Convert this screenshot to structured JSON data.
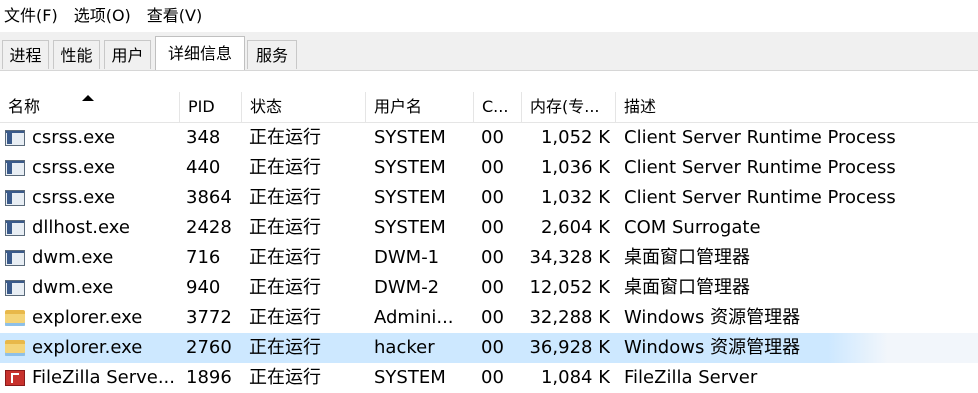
{
  "menu": [
    "文件(F)",
    "选项(O)",
    "查看(V)"
  ],
  "tabs": [
    {
      "label": "进程",
      "active": false
    },
    {
      "label": "性能",
      "active": false
    },
    {
      "label": "用户",
      "active": false
    },
    {
      "label": "详细信息",
      "active": true
    },
    {
      "label": "服务",
      "active": false
    }
  ],
  "table": {
    "headers": {
      "name": "名称",
      "pid": "PID",
      "status": "状态",
      "user": "用户名",
      "cpu": "C...",
      "mem": "内存(专...",
      "desc": "描述"
    },
    "sorted_column": "name",
    "sort_direction": "ascending",
    "rows": [
      {
        "icon": "app-window-icon",
        "name": "csrss.exe",
        "pid": "348",
        "status": "正在运行",
        "user": "SYSTEM",
        "cpu": "00",
        "mem": "1,052 K",
        "desc": "Client Server Runtime Process"
      },
      {
        "icon": "app-window-icon",
        "name": "csrss.exe",
        "pid": "440",
        "status": "正在运行",
        "user": "SYSTEM",
        "cpu": "00",
        "mem": "1,036 K",
        "desc": "Client Server Runtime Process"
      },
      {
        "icon": "app-window-icon",
        "name": "csrss.exe",
        "pid": "3864",
        "status": "正在运行",
        "user": "SYSTEM",
        "cpu": "00",
        "mem": "1,032 K",
        "desc": "Client Server Runtime Process"
      },
      {
        "icon": "app-window-icon",
        "name": "dllhost.exe",
        "pid": "2428",
        "status": "正在运行",
        "user": "SYSTEM",
        "cpu": "00",
        "mem": "2,604 K",
        "desc": "COM Surrogate"
      },
      {
        "icon": "app-window-icon",
        "name": "dwm.exe",
        "pid": "716",
        "status": "正在运行",
        "user": "DWM-1",
        "cpu": "00",
        "mem": "34,328 K",
        "desc": "桌面窗口管理器"
      },
      {
        "icon": "app-window-icon",
        "name": "dwm.exe",
        "pid": "940",
        "status": "正在运行",
        "user": "DWM-2",
        "cpu": "00",
        "mem": "12,052 K",
        "desc": "桌面窗口管理器"
      },
      {
        "icon": "folder-icon",
        "name": "explorer.exe",
        "pid": "3772",
        "status": "正在运行",
        "user": "Admini...",
        "cpu": "00",
        "mem": "32,288 K",
        "desc": "Windows 资源管理器"
      },
      {
        "icon": "folder-icon",
        "name": "explorer.exe",
        "pid": "2760",
        "status": "正在运行",
        "user": "hacker",
        "cpu": "00",
        "mem": "36,928 K",
        "desc": "Windows 资源管理器",
        "selected": true
      },
      {
        "icon": "filezilla-icon",
        "name": "FileZilla Serve...",
        "pid": "1896",
        "status": "正在运行",
        "user": "SYSTEM",
        "cpu": "00",
        "mem": "1,084 K",
        "desc": "FileZilla Server"
      }
    ]
  }
}
